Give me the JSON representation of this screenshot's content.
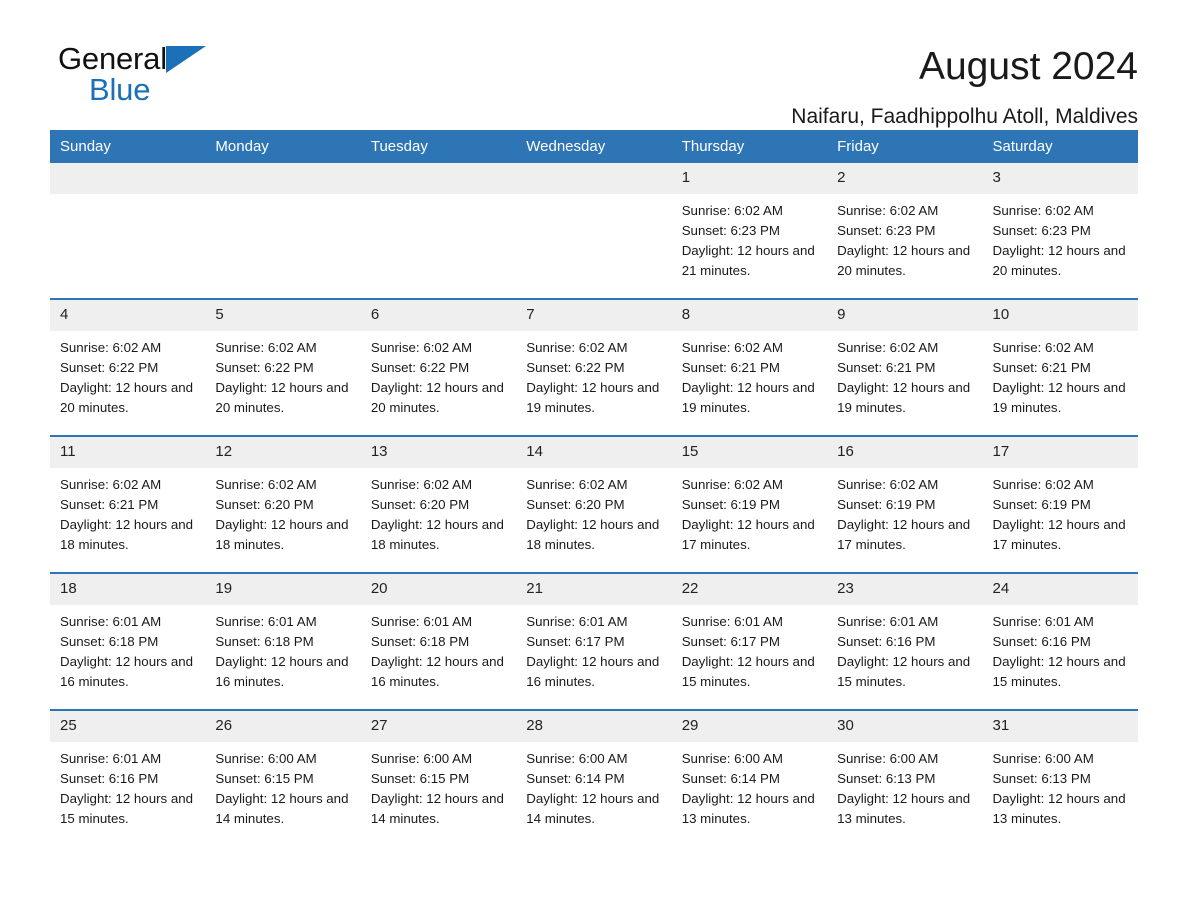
{
  "logo": {
    "word1": "General",
    "word2": "Blue",
    "triangle_color": "#1b70b8"
  },
  "header": {
    "title": "August 2024",
    "subtitle": "Naifaru, Faadhippolhu Atoll, Maldives"
  },
  "colors": {
    "header_blue": "#2e75b6",
    "daynum_band": "#efefef",
    "text": "#1a1a1a"
  },
  "weekdays": [
    "Sunday",
    "Monday",
    "Tuesday",
    "Wednesday",
    "Thursday",
    "Friday",
    "Saturday"
  ],
  "weeks": [
    [
      {
        "day": "",
        "blank": true
      },
      {
        "day": "",
        "blank": true
      },
      {
        "day": "",
        "blank": true
      },
      {
        "day": "",
        "blank": true
      },
      {
        "day": "1",
        "sunrise": "Sunrise: 6:02 AM",
        "sunset": "Sunset: 6:23 PM",
        "daylight": "Daylight: 12 hours and 21 minutes."
      },
      {
        "day": "2",
        "sunrise": "Sunrise: 6:02 AM",
        "sunset": "Sunset: 6:23 PM",
        "daylight": "Daylight: 12 hours and 20 minutes."
      },
      {
        "day": "3",
        "sunrise": "Sunrise: 6:02 AM",
        "sunset": "Sunset: 6:23 PM",
        "daylight": "Daylight: 12 hours and 20 minutes."
      }
    ],
    [
      {
        "day": "4",
        "sunrise": "Sunrise: 6:02 AM",
        "sunset": "Sunset: 6:22 PM",
        "daylight": "Daylight: 12 hours and 20 minutes."
      },
      {
        "day": "5",
        "sunrise": "Sunrise: 6:02 AM",
        "sunset": "Sunset: 6:22 PM",
        "daylight": "Daylight: 12 hours and 20 minutes."
      },
      {
        "day": "6",
        "sunrise": "Sunrise: 6:02 AM",
        "sunset": "Sunset: 6:22 PM",
        "daylight": "Daylight: 12 hours and 20 minutes."
      },
      {
        "day": "7",
        "sunrise": "Sunrise: 6:02 AM",
        "sunset": "Sunset: 6:22 PM",
        "daylight": "Daylight: 12 hours and 19 minutes."
      },
      {
        "day": "8",
        "sunrise": "Sunrise: 6:02 AM",
        "sunset": "Sunset: 6:21 PM",
        "daylight": "Daylight: 12 hours and 19 minutes."
      },
      {
        "day": "9",
        "sunrise": "Sunrise: 6:02 AM",
        "sunset": "Sunset: 6:21 PM",
        "daylight": "Daylight: 12 hours and 19 minutes."
      },
      {
        "day": "10",
        "sunrise": "Sunrise: 6:02 AM",
        "sunset": "Sunset: 6:21 PM",
        "daylight": "Daylight: 12 hours and 19 minutes."
      }
    ],
    [
      {
        "day": "11",
        "sunrise": "Sunrise: 6:02 AM",
        "sunset": "Sunset: 6:21 PM",
        "daylight": "Daylight: 12 hours and 18 minutes."
      },
      {
        "day": "12",
        "sunrise": "Sunrise: 6:02 AM",
        "sunset": "Sunset: 6:20 PM",
        "daylight": "Daylight: 12 hours and 18 minutes."
      },
      {
        "day": "13",
        "sunrise": "Sunrise: 6:02 AM",
        "sunset": "Sunset: 6:20 PM",
        "daylight": "Daylight: 12 hours and 18 minutes."
      },
      {
        "day": "14",
        "sunrise": "Sunrise: 6:02 AM",
        "sunset": "Sunset: 6:20 PM",
        "daylight": "Daylight: 12 hours and 18 minutes."
      },
      {
        "day": "15",
        "sunrise": "Sunrise: 6:02 AM",
        "sunset": "Sunset: 6:19 PM",
        "daylight": "Daylight: 12 hours and 17 minutes."
      },
      {
        "day": "16",
        "sunrise": "Sunrise: 6:02 AM",
        "sunset": "Sunset: 6:19 PM",
        "daylight": "Daylight: 12 hours and 17 minutes."
      },
      {
        "day": "17",
        "sunrise": "Sunrise: 6:02 AM",
        "sunset": "Sunset: 6:19 PM",
        "daylight": "Daylight: 12 hours and 17 minutes."
      }
    ],
    [
      {
        "day": "18",
        "sunrise": "Sunrise: 6:01 AM",
        "sunset": "Sunset: 6:18 PM",
        "daylight": "Daylight: 12 hours and 16 minutes."
      },
      {
        "day": "19",
        "sunrise": "Sunrise: 6:01 AM",
        "sunset": "Sunset: 6:18 PM",
        "daylight": "Daylight: 12 hours and 16 minutes."
      },
      {
        "day": "20",
        "sunrise": "Sunrise: 6:01 AM",
        "sunset": "Sunset: 6:18 PM",
        "daylight": "Daylight: 12 hours and 16 minutes."
      },
      {
        "day": "21",
        "sunrise": "Sunrise: 6:01 AM",
        "sunset": "Sunset: 6:17 PM",
        "daylight": "Daylight: 12 hours and 16 minutes."
      },
      {
        "day": "22",
        "sunrise": "Sunrise: 6:01 AM",
        "sunset": "Sunset: 6:17 PM",
        "daylight": "Daylight: 12 hours and 15 minutes."
      },
      {
        "day": "23",
        "sunrise": "Sunrise: 6:01 AM",
        "sunset": "Sunset: 6:16 PM",
        "daylight": "Daylight: 12 hours and 15 minutes."
      },
      {
        "day": "24",
        "sunrise": "Sunrise: 6:01 AM",
        "sunset": "Sunset: 6:16 PM",
        "daylight": "Daylight: 12 hours and 15 minutes."
      }
    ],
    [
      {
        "day": "25",
        "sunrise": "Sunrise: 6:01 AM",
        "sunset": "Sunset: 6:16 PM",
        "daylight": "Daylight: 12 hours and 15 minutes."
      },
      {
        "day": "26",
        "sunrise": "Sunrise: 6:00 AM",
        "sunset": "Sunset: 6:15 PM",
        "daylight": "Daylight: 12 hours and 14 minutes."
      },
      {
        "day": "27",
        "sunrise": "Sunrise: 6:00 AM",
        "sunset": "Sunset: 6:15 PM",
        "daylight": "Daylight: 12 hours and 14 minutes."
      },
      {
        "day": "28",
        "sunrise": "Sunrise: 6:00 AM",
        "sunset": "Sunset: 6:14 PM",
        "daylight": "Daylight: 12 hours and 14 minutes."
      },
      {
        "day": "29",
        "sunrise": "Sunrise: 6:00 AM",
        "sunset": "Sunset: 6:14 PM",
        "daylight": "Daylight: 12 hours and 13 minutes."
      },
      {
        "day": "30",
        "sunrise": "Sunrise: 6:00 AM",
        "sunset": "Sunset: 6:13 PM",
        "daylight": "Daylight: 12 hours and 13 minutes."
      },
      {
        "day": "31",
        "sunrise": "Sunrise: 6:00 AM",
        "sunset": "Sunset: 6:13 PM",
        "daylight": "Daylight: 12 hours and 13 minutes."
      }
    ]
  ]
}
